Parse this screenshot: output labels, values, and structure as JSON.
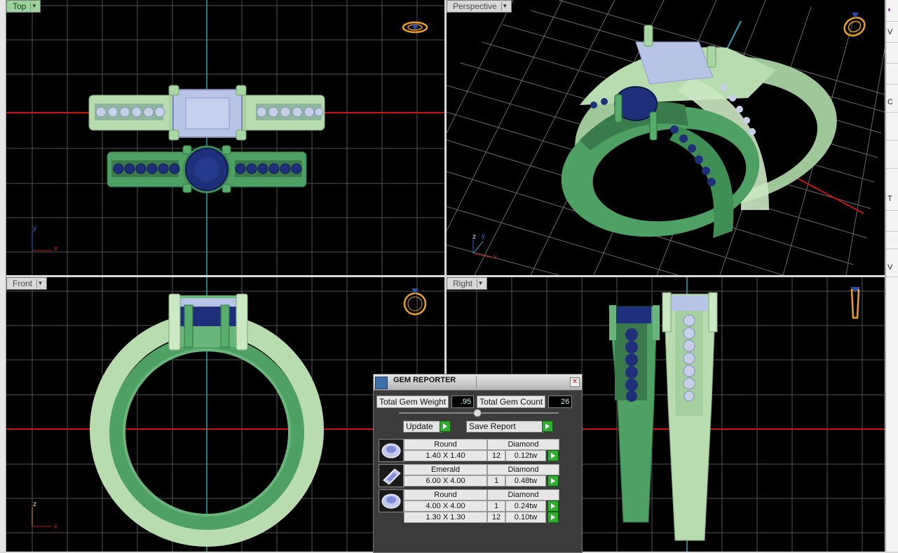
{
  "viewports": {
    "top": {
      "label": "Top",
      "axes": {
        "a": "y",
        "b": "x"
      }
    },
    "perspective": {
      "label": "Perspective",
      "axes": {
        "a": "z",
        "b": "y",
        "c": "x"
      }
    },
    "front": {
      "label": "Front",
      "axes": {
        "a": "z",
        "b": "x"
      }
    },
    "right": {
      "label": "Right"
    }
  },
  "gem_reporter": {
    "title": "GEM REPORTER",
    "total_weight_label": "Total Gem Weight",
    "total_weight_value": ".95",
    "total_count_label": "Total Gem Count",
    "total_count_value": "26",
    "update_label": "Update",
    "save_report_label": "Save Report",
    "groups": [
      {
        "shape": "Round",
        "material": "Diamond",
        "icon": "round-gem-icon",
        "rows": [
          {
            "size": "1.40 X 1.40",
            "count": "12",
            "weight": "0.12tw"
          }
        ]
      },
      {
        "shape": "Emerald",
        "material": "Diamond",
        "icon": "emerald-gem-icon",
        "rows": [
          {
            "size": "6.00 X 4.00",
            "count": "1",
            "weight": "0.48tw"
          }
        ]
      },
      {
        "shape": "Round",
        "material": "Diamond",
        "icon": "round-gem-icon",
        "rows": [
          {
            "size": "4.00 X 4.00",
            "count": "1",
            "weight": "0.24tw"
          },
          {
            "size": "1.30 X 1.30",
            "count": "12",
            "weight": "0.10tw"
          }
        ]
      }
    ]
  },
  "right_panel": {
    "letters": [
      "V",
      "C",
      "T",
      "V"
    ]
  },
  "colors": {
    "grid": "#5a5a5a",
    "light_green": "#b8dcb0",
    "dark_green": "#4fa064",
    "sapphire": "#1f2f7a",
    "diamond": "#b9c3e6",
    "axis_red": "#c81414",
    "axis_cyan": "#22a8b4"
  }
}
